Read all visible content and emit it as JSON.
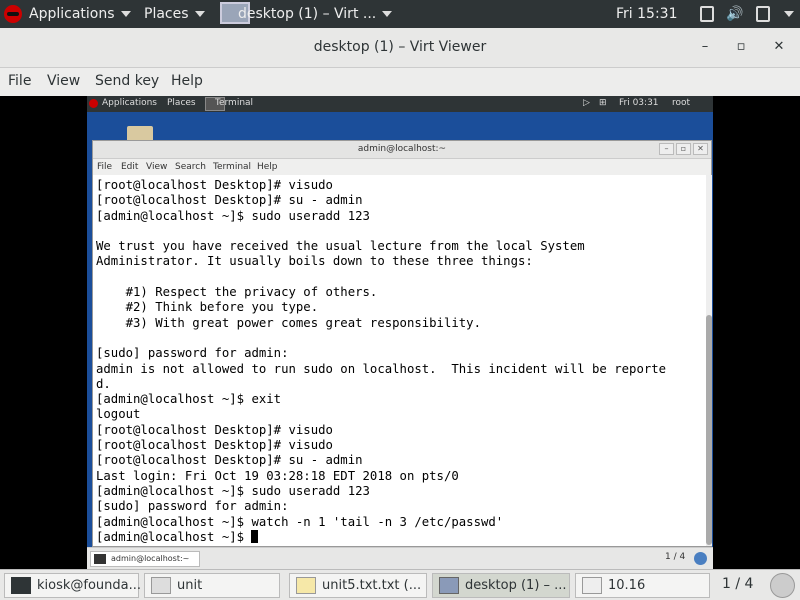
{
  "host_topbar": {
    "applications": "Applications",
    "places": "Places",
    "window_title": "desktop (1) – Virt ...",
    "clock": "Fri 15:31"
  },
  "viewer": {
    "title": "desktop (1) – Virt Viewer",
    "menu": [
      "File",
      "View",
      "Send key",
      "Help"
    ]
  },
  "guest_topbar": {
    "applications": "Applications",
    "places": "Places",
    "terminal": "Terminal",
    "clock": "Fri 03:31",
    "user": "root"
  },
  "terminal": {
    "title": "admin@localhost:~",
    "menu": [
      "File",
      "Edit",
      "View",
      "Search",
      "Terminal",
      "Help"
    ],
    "lines": [
      "[root@localhost Desktop]# visudo",
      "[root@localhost Desktop]# su - admin",
      "[admin@localhost ~]$ sudo useradd 123",
      "",
      "We trust you have received the usual lecture from the local System",
      "Administrator. It usually boils down to these three things:",
      "",
      "    #1) Respect the privacy of others.",
      "    #2) Think before you type.",
      "    #3) With great power comes great responsibility.",
      "",
      "[sudo] password for admin:",
      "admin is not allowed to run sudo on localhost.  This incident will be reporte",
      "d.",
      "[admin@localhost ~]$ exit",
      "logout",
      "[root@localhost Desktop]# visudo",
      "[root@localhost Desktop]# visudo",
      "[root@localhost Desktop]# su - admin",
      "Last login: Fri Oct 19 03:28:18 EDT 2018 on pts/0",
      "[admin@localhost ~]$ sudo useradd 123",
      "[sudo] password for admin:",
      "[admin@localhost ~]$ watch -n 1 'tail -n 3 /etc/passwd'"
    ],
    "prompt": "[admin@localhost ~]$ "
  },
  "guest_taskbar": {
    "task": "admin@localhost:~",
    "pager": "1 / 4"
  },
  "host_taskbar": {
    "tasks": [
      {
        "label": "kiosk@founda...",
        "icon": "terminal-icon"
      },
      {
        "label": "unit",
        "icon": "folder-icon"
      },
      {
        "label": "unit5.txt.txt (...",
        "icon": "text-editor-icon"
      },
      {
        "label": "desktop (1) – ...",
        "icon": "monitor-icon"
      },
      {
        "label": "10.16",
        "icon": "window-icon"
      }
    ],
    "pager": "1 / 4"
  }
}
